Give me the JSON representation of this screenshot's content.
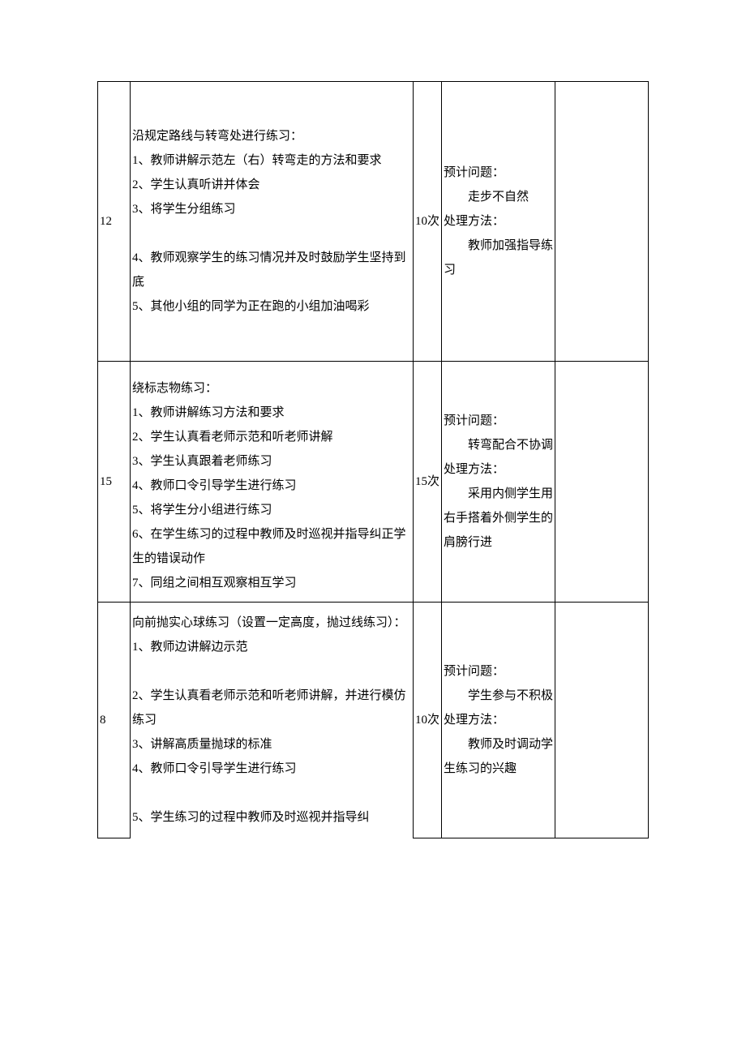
{
  "rows": [
    {
      "time": "12",
      "content": "沿规定路线与转弯处进行练习：\n1、教师讲解示范左（右）转弯走的方法和要求\n2、学生认真听讲并体会\n3、将学生分组练习\n\n4、教师观察学生的练习情况并及时鼓励学生坚持到底\n5、其他小组的同学为正在跑的小组加油喝彩",
      "count": "10次",
      "issue_label1": "预计问题：",
      "issue_text1": "走步不自然",
      "issue_label2": "处理方法：",
      "issue_text2": "教师加强指导练习"
    },
    {
      "time": "15",
      "content": "绕标志物练习：\n1、教师讲解练习方法和要求\n2、学生认真看老师示范和听老师讲解\n3、学生认真跟着老师练习\n4、教师口令引导学生进行练习\n5、将学生分小组进行练习\n6、在学生练习的过程中教师及时巡视并指导纠正学生的错误动作\n7、同组之间相互观察相互学习",
      "count": "15次",
      "issue_label1": "预计问题：",
      "issue_text1": "转弯配合不协调",
      "issue_label2": "处理方法：",
      "issue_text2": "采用内侧学生用右手搭着外侧学生的肩膀行进"
    },
    {
      "time": "8",
      "content": "向前抛实心球练习（设置一定高度，抛过线练习）：\n1、教师边讲解边示范\n\n2、学生认真看老师示范和听老师讲解，并进行模仿练习\n3、讲解高质量抛球的标准\n4、教师口令引导学生进行练习\n\n5、学生练习的过程中教师及时巡视并指导纠",
      "count": "10次",
      "issue_label1": "预计问题：",
      "issue_text1": "学生参与不积极",
      "issue_label2": "处理方法：",
      "issue_text2": "教师及时调动学生练习的兴趣"
    }
  ]
}
